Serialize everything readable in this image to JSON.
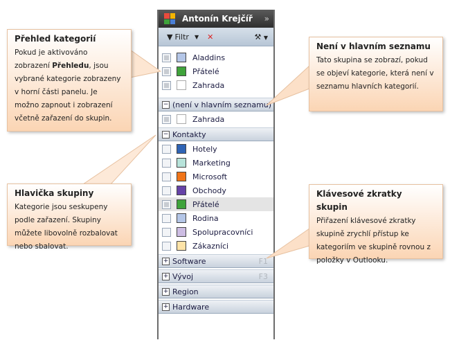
{
  "panel": {
    "title": "Antonín Krejčíř",
    "expand_icon": "»",
    "filter_label": "Filtr"
  },
  "overview": [
    {
      "label": "Aladdins",
      "color": "#b4c6e7",
      "checked": true
    },
    {
      "label": "Přátelé",
      "color": "#3fa33b",
      "checked": true
    },
    {
      "label": "Zahrada",
      "color": "#ffffff",
      "checked": true
    }
  ],
  "groups": {
    "not_main": {
      "label": "(není v hlavním seznamu)",
      "items": [
        {
          "label": "Zahrada",
          "color": "#ffffff"
        }
      ]
    },
    "contacts": {
      "label": "Kontakty",
      "items": [
        {
          "label": "Hotely",
          "color": "#2f64b5"
        },
        {
          "label": "Marketing",
          "color": "#b7e3da"
        },
        {
          "label": "Microsoft",
          "color": "#f07418"
        },
        {
          "label": "Obchody",
          "color": "#6643a8"
        },
        {
          "label": "Přátelé",
          "color": "#3fa33b"
        },
        {
          "label": "Rodina",
          "color": "#b4c6e7"
        },
        {
          "label": "Spolupracovníci",
          "color": "#cdbde3"
        },
        {
          "label": "Zákazníci",
          "color": "#fde3a7"
        }
      ]
    },
    "software": {
      "label": "Software",
      "key": "F1"
    },
    "vyvoj": {
      "label": "Vývoj",
      "key": "F3"
    },
    "region": {
      "label": "Region"
    },
    "hardware": {
      "label": "Hardware"
    }
  },
  "callouts": {
    "overview": {
      "title": "Přehled kategorií",
      "t1": "Pokud je aktivováno zobrazení ",
      "bold": "Přehledu",
      "t2": ", jsou vybrané kategorie zobrazeny v horní části panelu. Je možno zapnout i zobrazení včetně zařazení do skupin."
    },
    "not_main": {
      "title": "Není v hlavním seznamu",
      "text": "Tato skupina se zobrazí, pokud se objeví kategorie, která není v seznamu hlavních kategorií."
    },
    "group_header": {
      "title": "Hlavička skupiny",
      "text": "Kategorie jsou seskupeny podle zařazení. Skupiny můžete libovolně rozbalovat nebo sbalovat."
    },
    "shortcuts": {
      "title": "Klávesové zkratky skupin",
      "text": "Přiřazení klávesové zkratky skupině zrychlí přístup ke kategoriím ve skupině rovnou z položky v Outlooku."
    }
  }
}
